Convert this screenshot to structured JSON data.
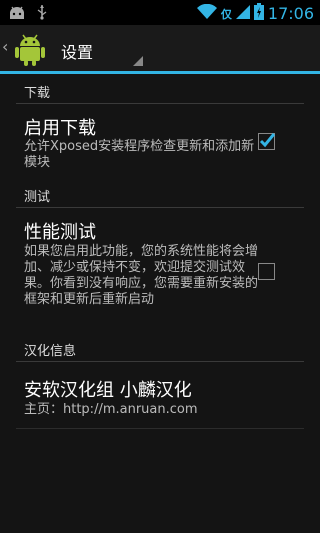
{
  "status_bar": {
    "time": "17:06",
    "ime_label": "仅"
  },
  "action_bar": {
    "title": "设置"
  },
  "sections": [
    {
      "header": "下载",
      "pref": {
        "title": "启用下载",
        "summary": "允许Xposed安装程序检查更新和添加新模块",
        "checked": true
      }
    },
    {
      "header": "测试",
      "pref": {
        "title": "性能测试",
        "summary": "如果您启用此功能，您的系统性能将会增加、减少或保持不变，欢迎提交测试效果。你看到没有响应，您需要重新安装的框架和更新后重新启动",
        "checked": false
      }
    },
    {
      "header": "汉化信息",
      "pref": {
        "title": "安软汉化组  小麟汉化",
        "summary": "主页：http://m.anruan.com"
      }
    }
  ],
  "colors": {
    "accent": "#33b5e5",
    "background": "#141414"
  }
}
